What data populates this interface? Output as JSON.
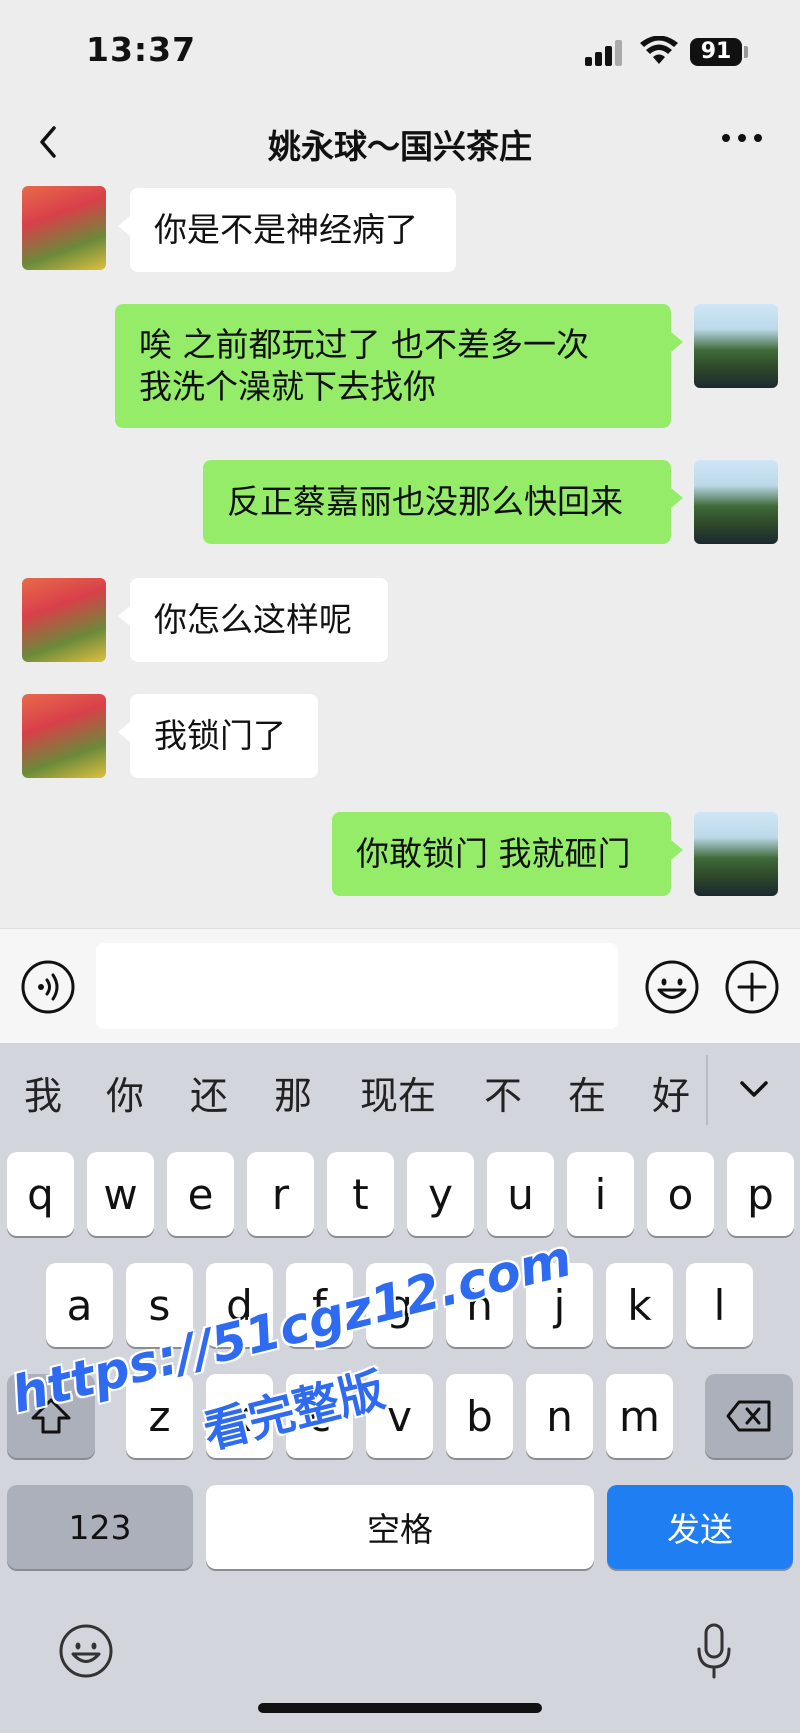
{
  "status_bar": {
    "time": "13:37",
    "battery": "91"
  },
  "nav": {
    "title": "姚永球～国兴茶庄"
  },
  "messages": [
    {
      "side": "left",
      "text": "你是不是神经病了"
    },
    {
      "side": "right",
      "text": "唉 之前都玩过了 也不差多一次\n我洗个澡就下去找你"
    },
    {
      "side": "right",
      "text": "反正蔡嘉丽也没那么快回来"
    },
    {
      "side": "left",
      "text": "你怎么这样呢"
    },
    {
      "side": "left",
      "text": "我锁门了"
    },
    {
      "side": "right",
      "text": "你敢锁门 我就砸门"
    }
  ],
  "input": {
    "value": ""
  },
  "keyboard": {
    "candidates": [
      "我",
      "你",
      "还",
      "那",
      "现在",
      "不",
      "在",
      "好"
    ],
    "row1": [
      "q",
      "w",
      "e",
      "r",
      "t",
      "y",
      "u",
      "i",
      "o",
      "p"
    ],
    "row2": [
      "a",
      "s",
      "d",
      "f",
      "g",
      "h",
      "j",
      "k",
      "l"
    ],
    "row3": [
      "z",
      "x",
      "c",
      "v",
      "b",
      "n",
      "m"
    ],
    "num_label": "123",
    "space_label": "空格",
    "send_label": "发送",
    "send_color": "#1f7ef2"
  },
  "watermark": {
    "url": "https://51cgz12.com",
    "sub": "看完整版"
  }
}
